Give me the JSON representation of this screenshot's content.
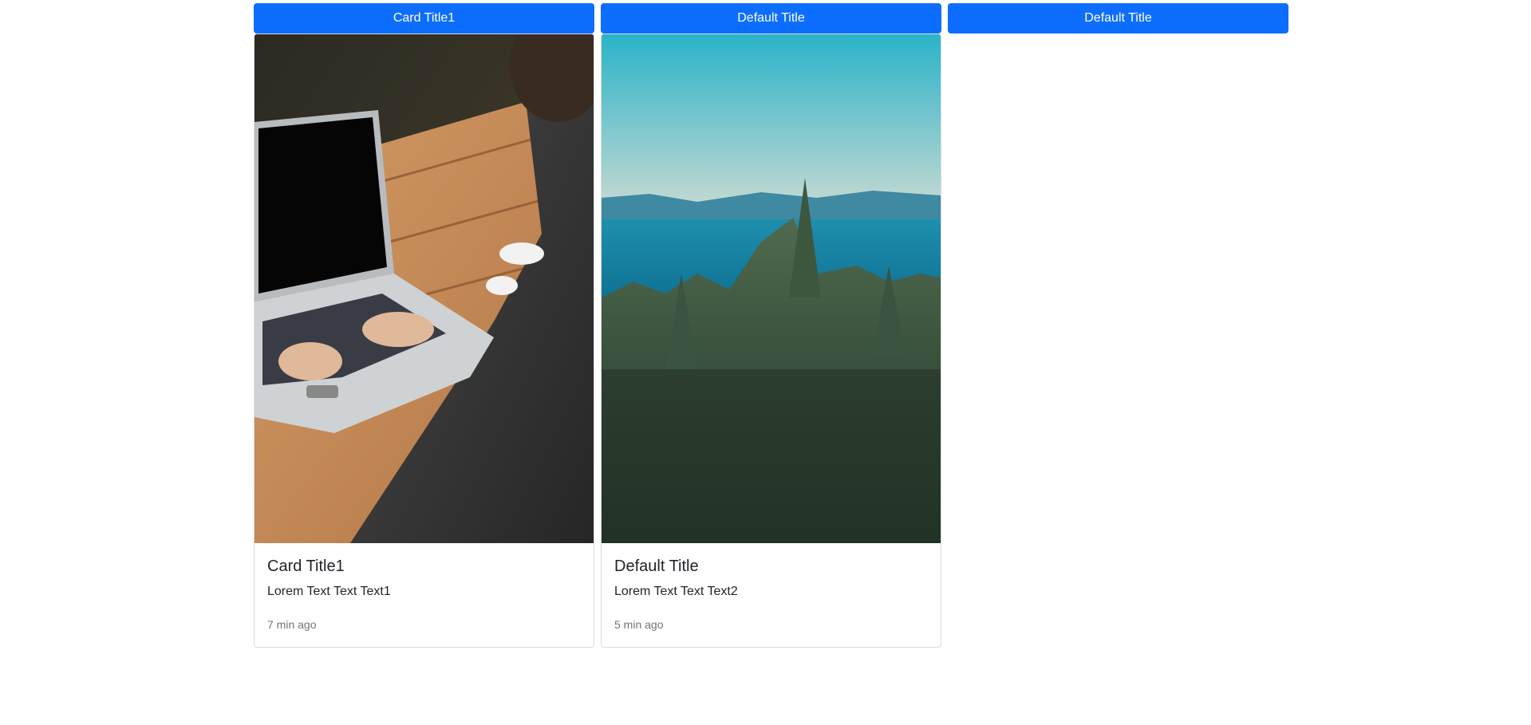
{
  "colors": {
    "primary": "#0d6efd",
    "muted_text": "#6c757d",
    "body_text": "#212529",
    "card_border": "#dcdcdc"
  },
  "buttons": [
    {
      "label": "Card Title1"
    },
    {
      "label": "Default Title"
    },
    {
      "label": "Default Title"
    }
  ],
  "cards": [
    {
      "image": "laptop-photo",
      "title": "Card Title1",
      "text": "Lorem Text Text Text1",
      "meta": "7 min ago"
    },
    {
      "image": "forest-lake-photo",
      "title": "Default Title",
      "text": "Lorem Text Text Text2",
      "meta": "5 min ago"
    }
  ]
}
